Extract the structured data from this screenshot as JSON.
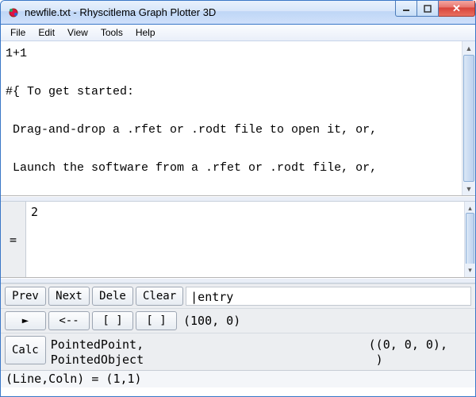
{
  "window": {
    "title": "newfile.txt - Rhyscitlema Graph Plotter 3D"
  },
  "menu": {
    "file": "File",
    "edit": "Edit",
    "view": "View",
    "tools": "Tools",
    "help": "Help"
  },
  "editor": {
    "content": "1+1\n\n#{ To get started:\n\n Drag-and-drop a .rfet or .rodt file to open it, or,\n\n Launch the software from a .rfet or .rodt file, or,\n\n Go to Menu -> File -> Open... then do Evaluate (=).\n}#"
  },
  "result": {
    "eq": "=",
    "value": "2"
  },
  "nav": {
    "prev": "Prev",
    "next": "Next",
    "dele": "Dele",
    "clear": "Clear",
    "entry": "|entry"
  },
  "play": {
    "play": "►",
    "back": "<--",
    "br1": "[ ]",
    "br2": "[   ]",
    "coords": "(100, 0)"
  },
  "pointed": {
    "calc": "Calc",
    "label": "PointedPoint,\nPointedObject",
    "value": "((0, 0, 0),\n )"
  },
  "status": {
    "text": "(Line,Coln) = (1,1)"
  }
}
